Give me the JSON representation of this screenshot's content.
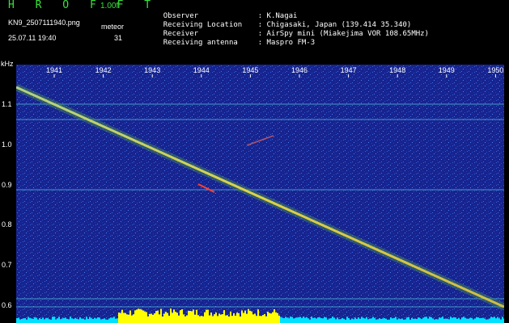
{
  "header": {
    "app_title": "H R O F F T",
    "version": "1.00f",
    "filename": "KN9_2507111940.png",
    "timestamp": "25.07.11 19:40",
    "meteor_label": "meteor",
    "meteor_count": "31"
  },
  "info": [
    {
      "key": "Observer",
      "value": ": K.Nagai"
    },
    {
      "key": "Receiving Location",
      "value": ": Chigasaki, Japan (139.414 35.340)"
    },
    {
      "key": "Receiver",
      "value": ": AirSpy mini (Miakejima VOR 108.65MHz)"
    },
    {
      "key": "Receiving antenna",
      "value": ": Maspro FM-3"
    }
  ],
  "plot": {
    "y_unit": "kHz",
    "y_ticks": [
      "1.1",
      "1.0",
      "0.9",
      "0.8",
      "0.7",
      "0.6"
    ],
    "x_ticks": [
      "1941",
      "1942",
      "1943",
      "1944",
      "1945",
      "1946",
      "1947",
      "1948",
      "1949",
      "1950"
    ],
    "colors": {
      "background": "#1a2a9e",
      "noise_light": "#3c6ce0",
      "signal": "#f0e040",
      "signal_core": "#ff4030",
      "scale_bar": "#00e0ff",
      "amplitude_bar": "#ffff00"
    }
  }
}
